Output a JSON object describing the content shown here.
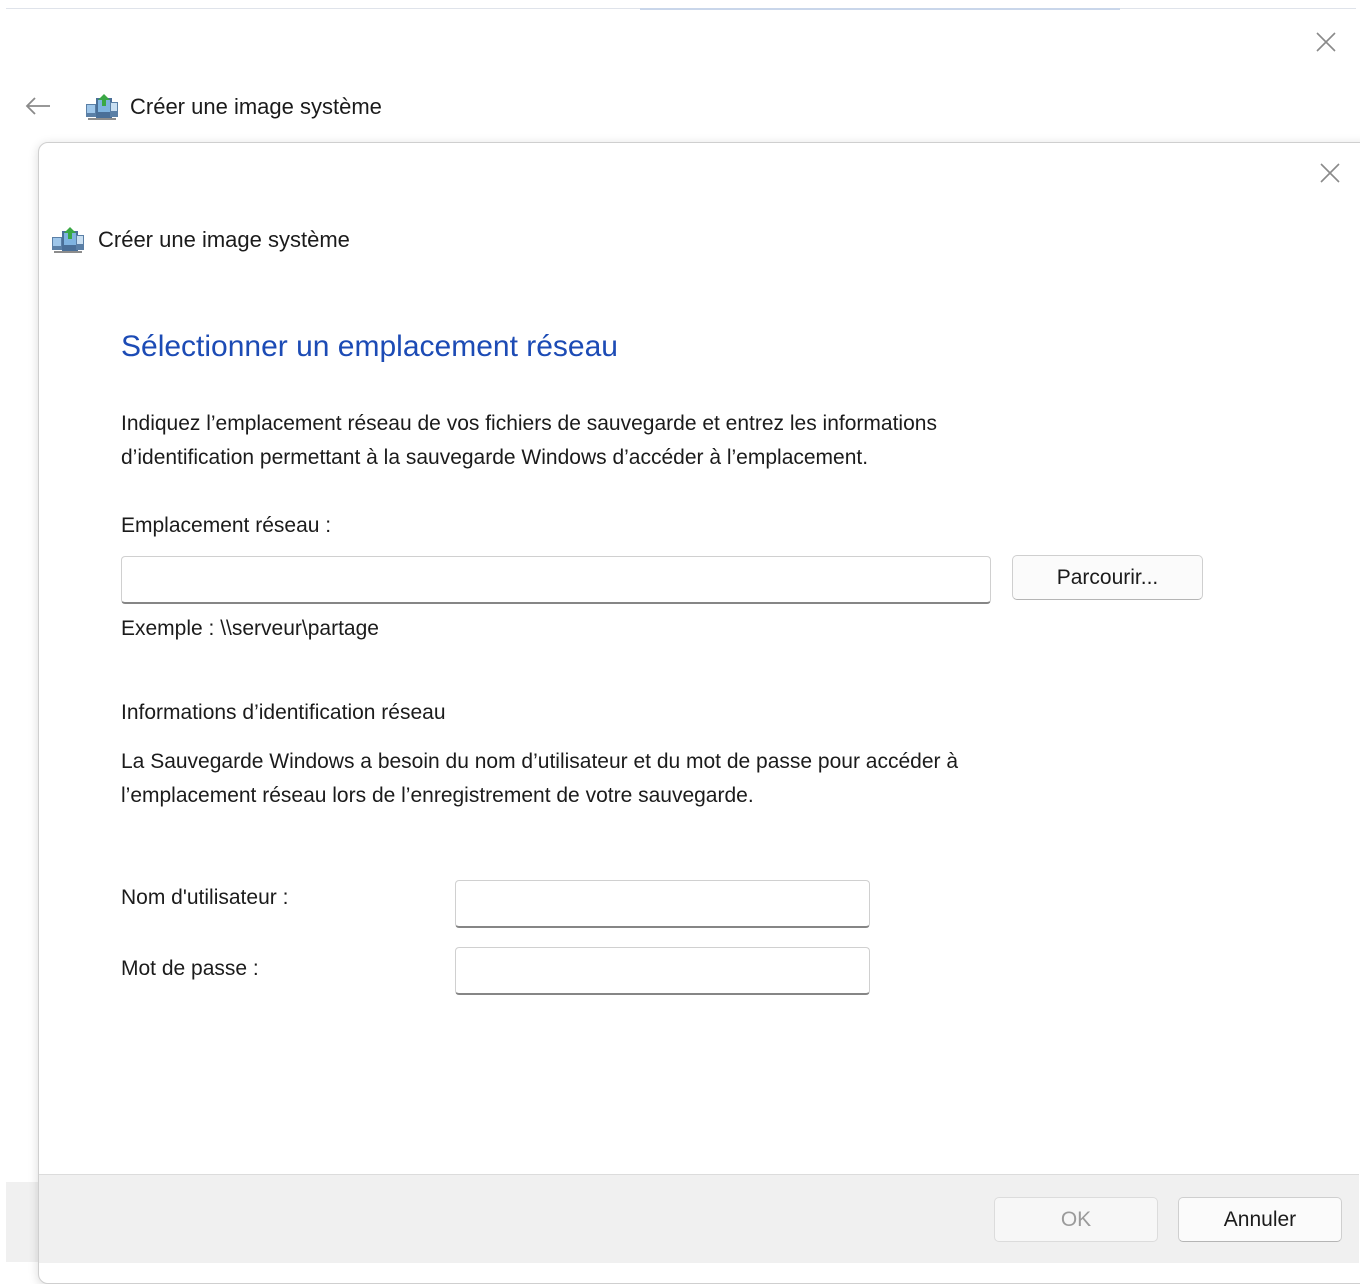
{
  "outer": {
    "title": "Créer une image système",
    "close_icon": "close-icon",
    "back_icon": "back-arrow-icon"
  },
  "dialog": {
    "title": "Créer une image système",
    "heading": "Sélectionner un emplacement réseau",
    "intro_line1": "Indiquez l’emplacement réseau de vos fichiers de sauvegarde et entrez les informations",
    "intro_line2": "d’identification permettant à la sauvegarde Windows d’accéder à l’emplacement.",
    "location_label": "Emplacement réseau :",
    "location_value": "",
    "browse_label": "Parcourir...",
    "example_text": "Exemple : \\\\serveur\\partage",
    "credentials_heading": "Informations d’identification réseau",
    "credentials_line1": "La Sauvegarde Windows a besoin du nom d’utilisateur et du mot de passe pour accéder à",
    "credentials_line2": "l’emplacement réseau lors de l’enregistrement de votre sauvegarde.",
    "username_label": "Nom d'utilisateur :",
    "username_value": "",
    "password_label": "Mot de passe :",
    "password_value": "",
    "ok_label": "OK",
    "cancel_label": "Annuler"
  },
  "colors": {
    "heading": "#1c4bb5",
    "footer": "#f0f0f0",
    "disabled_text": "#9b9b9b"
  }
}
